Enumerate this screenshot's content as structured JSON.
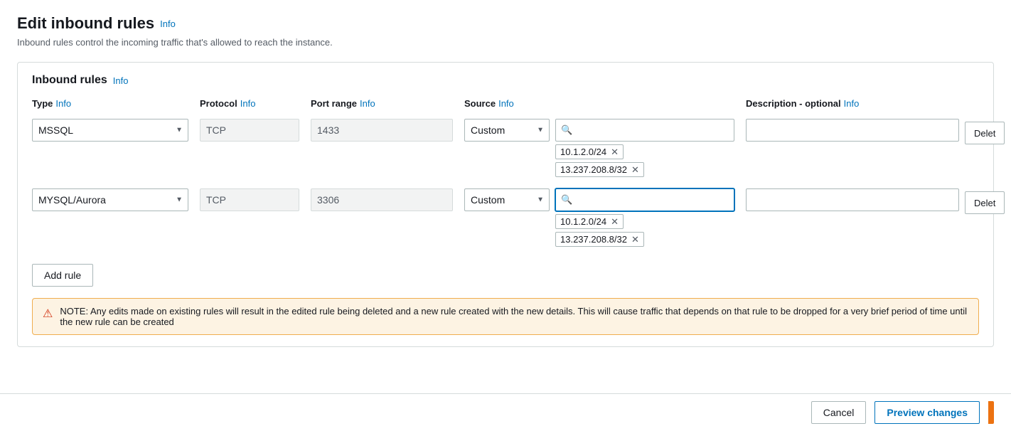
{
  "page": {
    "title": "Edit inbound rules",
    "title_info": "Info",
    "description": "Inbound rules control the incoming traffic that's allowed to reach the instance."
  },
  "inbound_rules_section": {
    "heading": "Inbound rules",
    "info_link": "Info"
  },
  "columns": {
    "type": "Type",
    "type_info": "Info",
    "protocol": "Protocol",
    "protocol_info": "Info",
    "port_range": "Port range",
    "port_range_info": "Info",
    "source": "Source",
    "source_info": "Info",
    "description": "Description - optional",
    "description_info": "Info"
  },
  "rules": [
    {
      "id": "rule1",
      "type_value": "MSSQL",
      "protocol_value": "TCP",
      "port_range_value": "1433",
      "source_label": "Custom",
      "search_placeholder": "",
      "search_focused": false,
      "tags": [
        "10.1.2.0/24",
        "13.237.208.8/32"
      ],
      "description_value": "",
      "delete_label": "Delet"
    },
    {
      "id": "rule2",
      "type_value": "MYSQL/Aurora",
      "protocol_value": "TCP",
      "port_range_value": "3306",
      "source_label": "Custom",
      "search_placeholder": "",
      "search_focused": true,
      "tags": [
        "10.1.2.0/24",
        "13.237.208.8/32"
      ],
      "description_value": "",
      "delete_label": "Delet"
    }
  ],
  "add_rule_label": "Add rule",
  "note": {
    "text": "NOTE: Any edits made on existing rules will result in the edited rule being deleted and a new rule created with the new details. This will cause traffic that depends on that rule to be dropped for a very brief period of time until the new rule can be created"
  },
  "footer": {
    "cancel_label": "Cancel",
    "preview_label": "Preview changes"
  }
}
